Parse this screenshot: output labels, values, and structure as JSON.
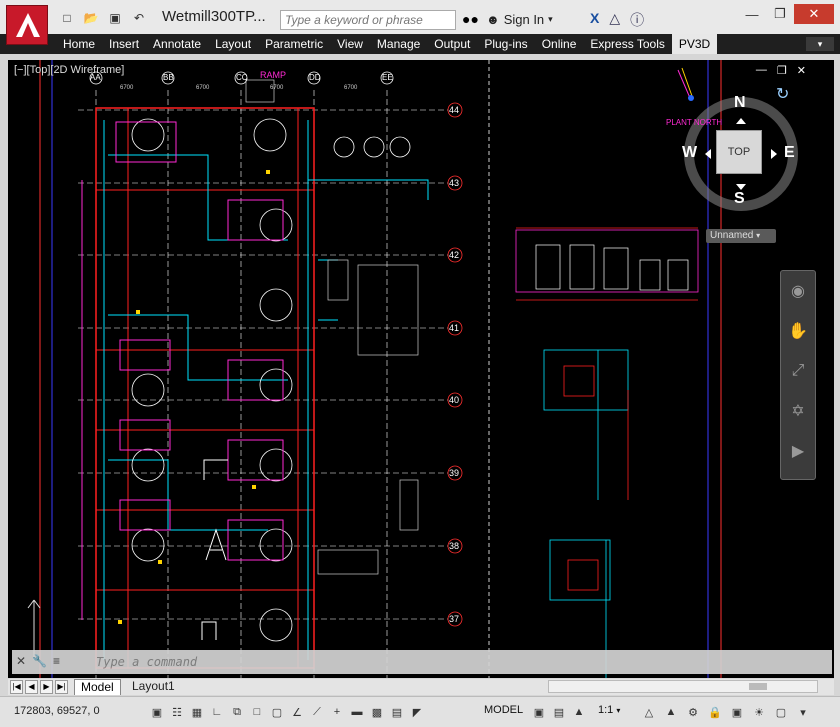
{
  "app": {
    "title": "Wetmill300TP...",
    "search_placeholder": "Type a keyword or phrase",
    "signin": "Sign In"
  },
  "ribbon": {
    "tabs": [
      "Home",
      "Insert",
      "Annotate",
      "Layout",
      "Parametric",
      "View",
      "Manage",
      "Output",
      "Plug-ins",
      "Online",
      "Express Tools",
      "PV3D"
    ],
    "active_tab": "PV3D"
  },
  "viewport": {
    "label": "[−][Top][2D Wireframe]",
    "viewcube_face": "TOP",
    "compass": {
      "n": "N",
      "s": "S",
      "e": "E",
      "w": "W"
    },
    "ucs_name": "Unnamed",
    "plant_north": "PLANT NORTH",
    "ramp": "RAMP"
  },
  "drawing": {
    "col_bubbles": [
      "AA",
      "BB",
      "CC",
      "DD",
      "EE"
    ],
    "row_bubbles": [
      "44",
      "43",
      "42",
      "41",
      "40",
      "39",
      "38",
      "37"
    ],
    "dims": [
      "6700",
      "6700",
      "6700",
      "6700",
      "6700",
      "6700",
      "6700"
    ]
  },
  "command": {
    "placeholder": "Type a command"
  },
  "layout_tabs": [
    "Model",
    "Layout1"
  ],
  "status": {
    "coords": "172803, 69527, 0",
    "model": "MODEL",
    "scale": "1:1"
  },
  "colors": {
    "canvas": "#000000",
    "app_red": "#c8192a",
    "ribbon": "#1f1f1f"
  }
}
